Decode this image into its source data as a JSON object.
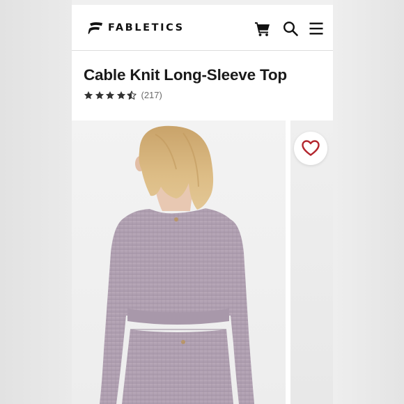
{
  "brand": {
    "name": "FABLETICS"
  },
  "header": {
    "icons": [
      "cart-icon",
      "search-icon",
      "menu-icon"
    ]
  },
  "product": {
    "title": "Cable Knit Long-Sleeve Top",
    "rating_stars": 4.5,
    "review_count": "(217)"
  },
  "gallery": {
    "favorite_icon": "heart-outline-icon"
  },
  "colors": {
    "text": "#1a1a1a",
    "heart": "#b3262e",
    "garment": "#b3a3b3",
    "hair": "#d6b57d"
  }
}
